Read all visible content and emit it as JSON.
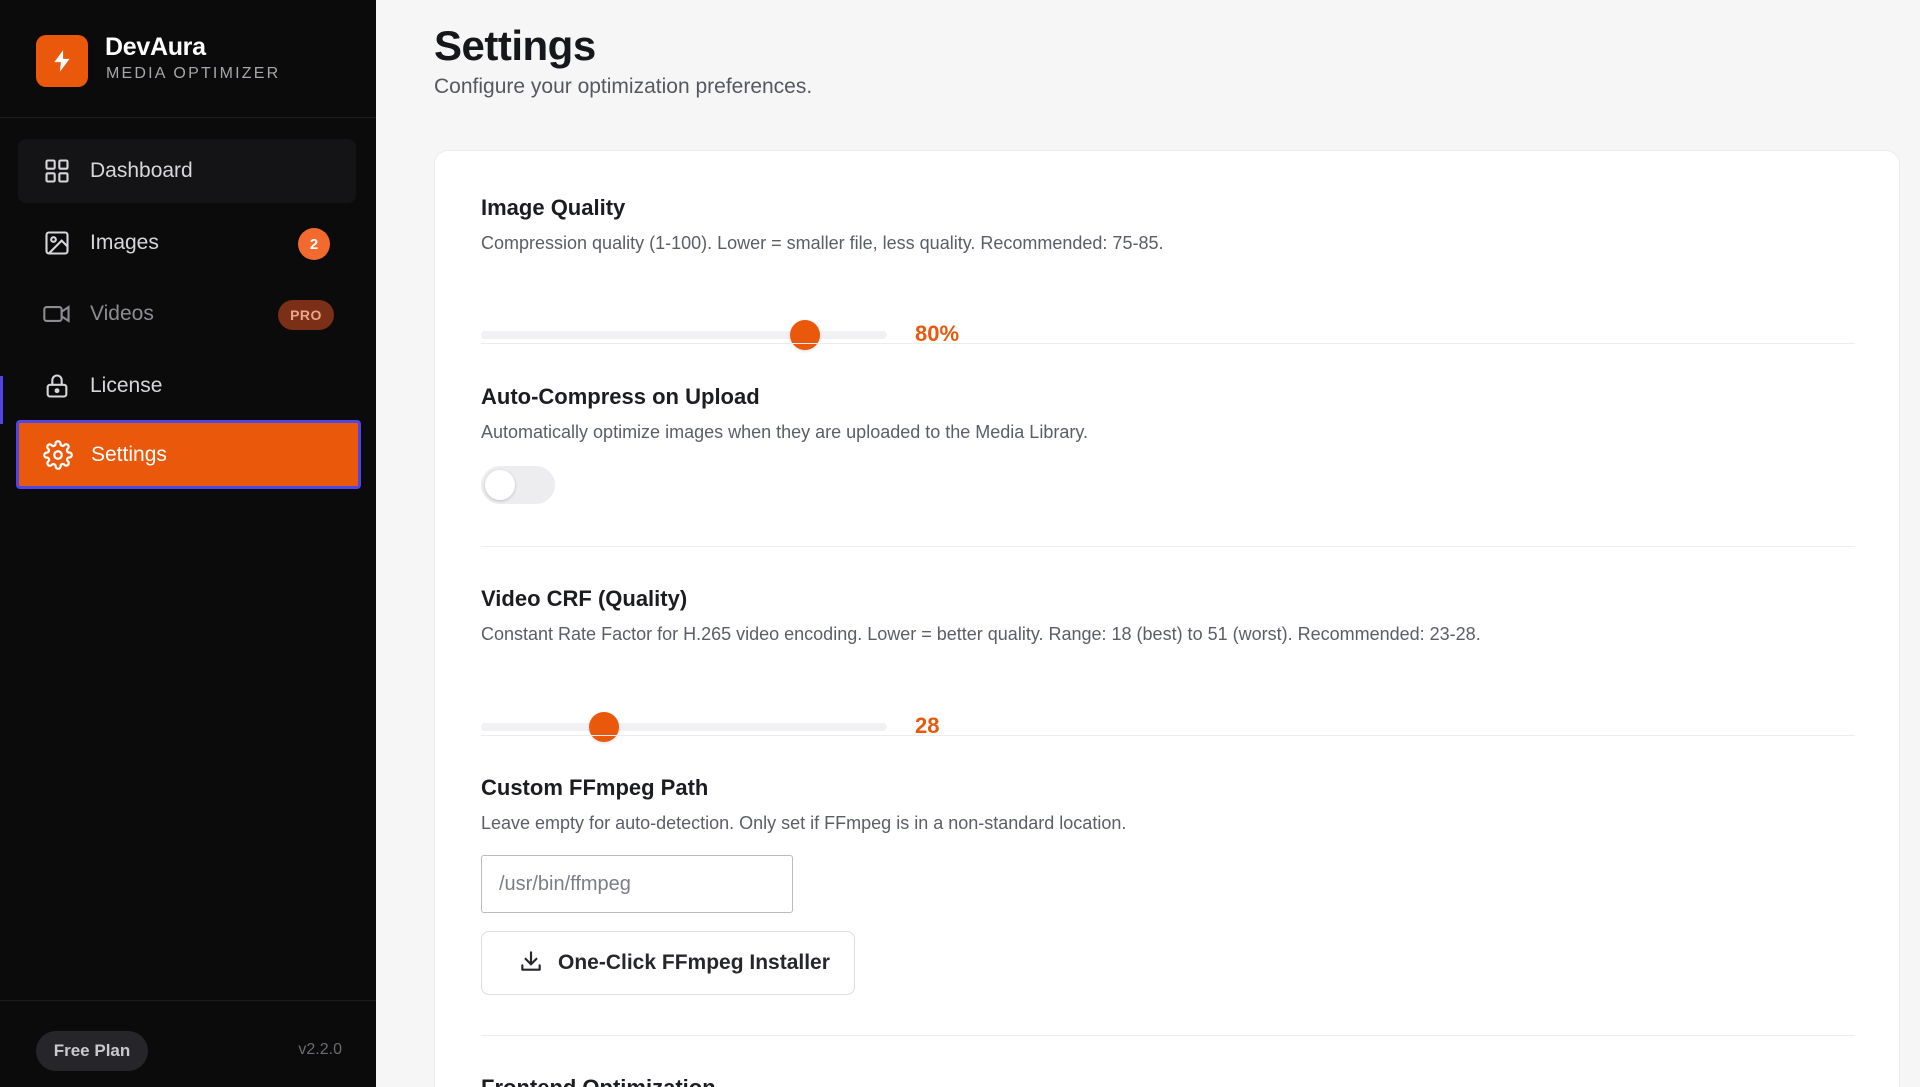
{
  "brand": {
    "name": "DevAura",
    "subtitle": "MEDIA OPTIMIZER",
    "accent": "#ea580c"
  },
  "nav": {
    "dashboard": {
      "label": "Dashboard",
      "icon": "grid-icon"
    },
    "images": {
      "label": "Images",
      "icon": "image-icon",
      "badge": "2"
    },
    "videos": {
      "label": "Videos",
      "icon": "video-camera-icon",
      "badge": "PRO"
    },
    "license": {
      "label": "License",
      "icon": "lock-icon"
    },
    "settings": {
      "label": "Settings",
      "icon": "gear-icon",
      "active": true
    }
  },
  "footer": {
    "plan": "Free Plan",
    "version": "v2.2.0"
  },
  "page": {
    "title": "Settings",
    "subtitle": "Configure your optimization preferences."
  },
  "settings": {
    "image_quality": {
      "title": "Image Quality",
      "description": "Compression quality (1-100). Lower = smaller file, less quality. Recommended: 75-85.",
      "value_label": "80%",
      "value": 80,
      "min": 1,
      "max": 100
    },
    "auto_compress": {
      "title": "Auto-Compress on Upload",
      "description": "Automatically optimize images when they are uploaded to the Media Library.",
      "enabled": false
    },
    "video_crf": {
      "title": "Video CRF (Quality)",
      "description": "Constant Rate Factor for H.265 video encoding. Lower = better quality. Range: 18 (best) to 51 (worst). Recommended: 23-28.",
      "value_label": "28",
      "value": 28,
      "min": 18,
      "max": 51
    },
    "ffmpeg_path": {
      "title": "Custom FFmpeg Path",
      "description": "Leave empty for auto-detection. Only set if FFmpeg is in a non-standard location.",
      "placeholder": "/usr/bin/ffmpeg",
      "value": "",
      "installer_label": "One-Click FFmpeg Installer"
    },
    "frontend": {
      "title": "Frontend Optimization"
    }
  }
}
